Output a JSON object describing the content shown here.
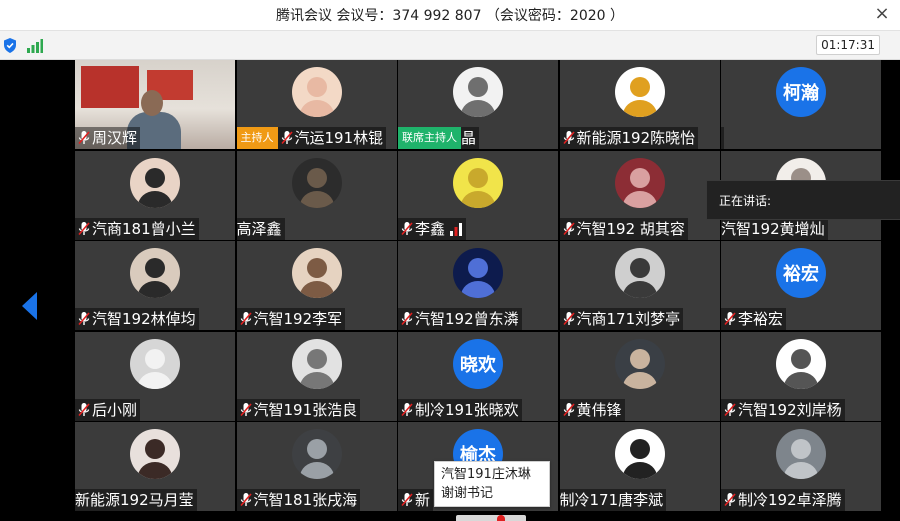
{
  "window": {
    "title": "腾讯会议 会议号：374 992 807 （会议密码：2020 ）",
    "close_glyph": "×"
  },
  "toolbar": {
    "timer": "01:17:31",
    "icons": [
      "shield-icon",
      "signal-icon"
    ]
  },
  "speaking": {
    "label": "正在讲话:"
  },
  "tooltip": {
    "line1": "汽智191庄沐琳",
    "line2": "谢谢书记"
  },
  "colors": {
    "avatar_text_bg": "#1a73e8",
    "host_badge": "#f09a15",
    "cohost_badge": "#1fb36b",
    "tile_bg": "#3b3b3b"
  },
  "participants": [
    {
      "name": "周汉辉",
      "mic": true,
      "video": true
    },
    {
      "name": "汽运191林锟",
      "mic": true,
      "badge": "主持人",
      "badge_type": "host",
      "avatar": "baby-photo"
    },
    {
      "name": "晶",
      "mic": false,
      "badge": "联席主持人",
      "badge_type": "cohost",
      "avatar": "cat-photo"
    },
    {
      "name": "新能源192陈晓怡",
      "mic": true,
      "avatar": "pooh-photo"
    },
    {
      "name": "",
      "mic": false,
      "avatar_text": "柯瀚"
    },
    {
      "name": "汽商181曾小兰",
      "mic": true,
      "avatar": "girl-photo"
    },
    {
      "name": "高泽鑫",
      "mic": false,
      "avatar": "dark-photo"
    },
    {
      "name": "李鑫",
      "mic": true,
      "volume": true,
      "avatar": "sponge-photo"
    },
    {
      "name": "汽智192 胡其容",
      "mic": true,
      "avatar": "red-photo"
    },
    {
      "name": "汽智192黄增灿",
      "mic": false,
      "avatar": "anime-photo"
    },
    {
      "name": "汽智192林倬均",
      "mic": true,
      "avatar": "child-photo"
    },
    {
      "name": "汽智192李军",
      "mic": true,
      "avatar": "boy-photo"
    },
    {
      "name": "汽智192曾东潾",
      "mic": true,
      "avatar": "night-photo"
    },
    {
      "name": "汽商171刘梦亭",
      "mic": true,
      "avatar": "bw-photo"
    },
    {
      "name": "李裕宏",
      "mic": true,
      "avatar_text": "裕宏"
    },
    {
      "name": "后小刚",
      "mic": true,
      "avatar": "default-person"
    },
    {
      "name": "汽智191张浩良",
      "mic": true,
      "avatar": "statue-photo"
    },
    {
      "name": "制冷191张晓欢",
      "mic": true,
      "avatar_text": "晓欢"
    },
    {
      "name": "黄伟锋",
      "mic": true,
      "avatar": "man-photo"
    },
    {
      "name": "汽智192刘岸杨",
      "mic": true,
      "avatar": "sketch-photo"
    },
    {
      "name": "新能源192马月莹",
      "mic": false,
      "avatar": "woman-photo"
    },
    {
      "name": "汽智181张戌海",
      "mic": true,
      "avatar": "helmet-photo"
    },
    {
      "name": "新",
      "mic": true,
      "avatar_text": "榆杰"
    },
    {
      "name": "制冷171唐李斌",
      "mic": false,
      "avatar": "meme-photo"
    },
    {
      "name": "制冷192卓泽腾",
      "mic": true,
      "avatar": "grey-photo"
    }
  ]
}
